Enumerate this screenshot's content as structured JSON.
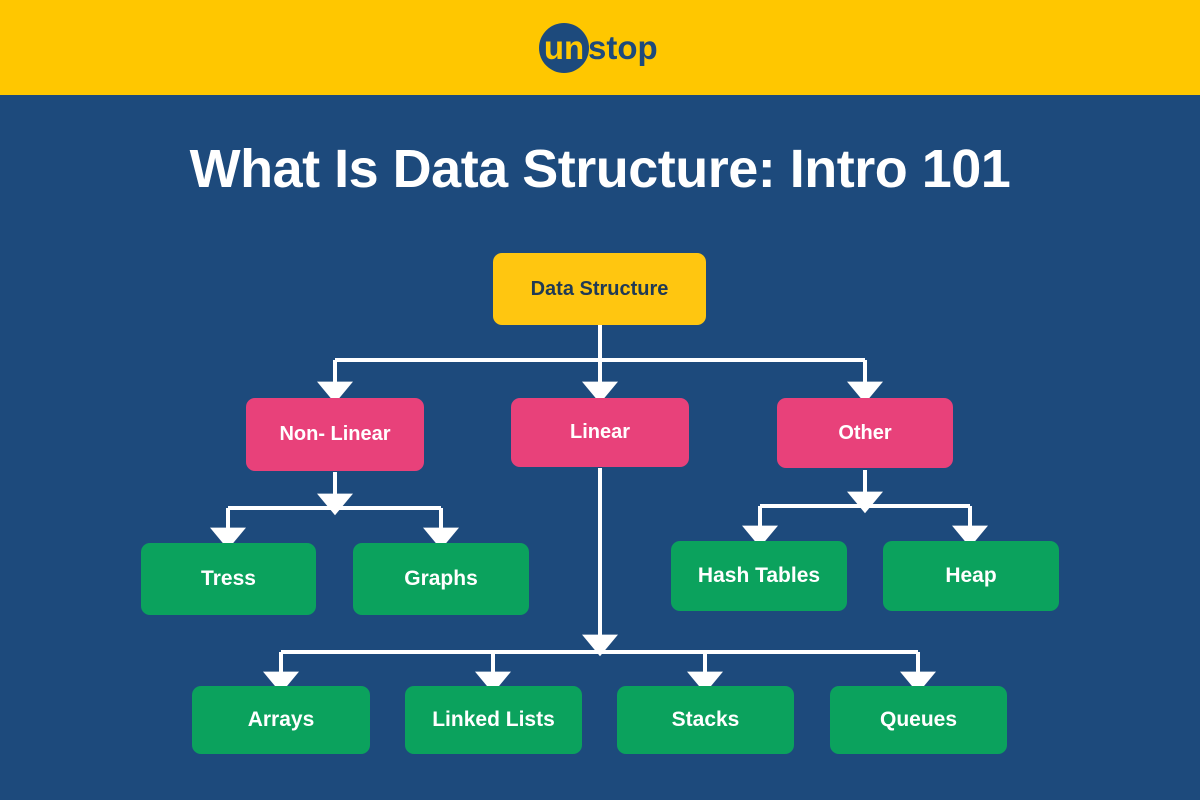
{
  "header": {
    "logo_name": "unstop-logo",
    "logo_text_primary": "un",
    "logo_text_secondary": "stop",
    "background_color": "#ffc700",
    "circle_color": "#1d4a7c",
    "wordmark_color": "#1d4a7c"
  },
  "page": {
    "background_color": "#1d4a7c",
    "title": "What Is Data Structure: Intro 101",
    "title_color": "#ffffff"
  },
  "colors": {
    "root": "#ffc610",
    "root_text": "#203a55",
    "category": "#e8417a",
    "leaf": "#0ba25d",
    "node_text": "#ffffff",
    "connector": "#ffffff"
  },
  "chart_data": {
    "type": "diagram",
    "title": "What Is Data Structure: Intro 101",
    "diagram_kind": "tree-hierarchy",
    "root": {
      "label": "Data Structure",
      "level": 0,
      "color": "#ffc610"
    },
    "nodes": [
      {
        "id": "root",
        "label": "Data Structure",
        "level": 0,
        "parent": null,
        "color": "#ffc610"
      },
      {
        "id": "non-linear",
        "label": "Non- Linear",
        "level": 1,
        "parent": "root",
        "color": "#e8417a"
      },
      {
        "id": "linear",
        "label": "Linear",
        "level": 1,
        "parent": "root",
        "color": "#e8417a"
      },
      {
        "id": "other",
        "label": "Other",
        "level": 1,
        "parent": "root",
        "color": "#e8417a"
      },
      {
        "id": "tress",
        "label": "Tress",
        "level": 2,
        "parent": "non-linear",
        "color": "#0ba25d"
      },
      {
        "id": "graphs",
        "label": "Graphs",
        "level": 2,
        "parent": "non-linear",
        "color": "#0ba25d"
      },
      {
        "id": "hash-tables",
        "label": "Hash Tables",
        "level": 2,
        "parent": "other",
        "color": "#0ba25d"
      },
      {
        "id": "heap",
        "label": "Heap",
        "level": 2,
        "parent": "other",
        "color": "#0ba25d"
      },
      {
        "id": "arrays",
        "label": "Arrays",
        "level": 3,
        "parent": "linear",
        "color": "#0ba25d"
      },
      {
        "id": "linked-lists",
        "label": "Linked Lists",
        "level": 3,
        "parent": "linear",
        "color": "#0ba25d"
      },
      {
        "id": "stacks",
        "label": "Stacks",
        "level": 3,
        "parent": "linear",
        "color": "#0ba25d"
      },
      {
        "id": "queues",
        "label": "Queues",
        "level": 3,
        "parent": "linear",
        "color": "#0ba25d"
      }
    ],
    "edges": [
      {
        "from": "root",
        "to": "non-linear"
      },
      {
        "from": "root",
        "to": "linear"
      },
      {
        "from": "root",
        "to": "other"
      },
      {
        "from": "non-linear",
        "to": "tress"
      },
      {
        "from": "non-linear",
        "to": "graphs"
      },
      {
        "from": "other",
        "to": "hash-tables"
      },
      {
        "from": "other",
        "to": "heap"
      },
      {
        "from": "linear",
        "to": "arrays"
      },
      {
        "from": "linear",
        "to": "linked-lists"
      },
      {
        "from": "linear",
        "to": "stacks"
      },
      {
        "from": "linear",
        "to": "queues"
      }
    ]
  },
  "nodes": {
    "root": "Data Structure",
    "non_linear": "Non- Linear",
    "linear": "Linear",
    "other": "Other",
    "tress": "Tress",
    "graphs": "Graphs",
    "hash_tables": "Hash Tables",
    "heap": "Heap",
    "arrays": "Arrays",
    "linked_lists": "Linked Lists",
    "stacks": "Stacks",
    "queues": "Queues"
  }
}
